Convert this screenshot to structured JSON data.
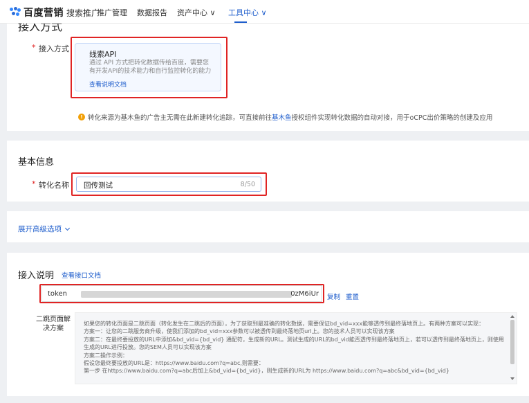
{
  "nav": {
    "brand": "百度营销",
    "brand_sub": "搜索推广",
    "items": [
      {
        "label": "推广管理"
      },
      {
        "label": "数据报告"
      },
      {
        "label": "资产中心"
      },
      {
        "label": "工具中心"
      }
    ],
    "active": "工具中心"
  },
  "access": {
    "section_title": "接入方式",
    "field_label": "接入方式",
    "required_mark": "*",
    "card": {
      "title": "线索API",
      "desc": "通过 API 方式把转化数据传给百度，需要您有开发API的技术能力和自行监控转化的能力",
      "link": "查看说明文档"
    },
    "notice": {
      "icon": "info-icon",
      "before": "转化来源为基木鱼的广告主无需在此新建转化追踪，可直接前往",
      "link": "基木鱼",
      "after": "授权组件实现转化数据的自动对接，用于oCPC出价策略的创建及应用"
    }
  },
  "basic": {
    "section_title": "基本信息",
    "field_label": "转化名称",
    "required_mark": "*",
    "value": "回传测试",
    "counter": "8/50"
  },
  "advanced": {
    "label": "展开高级选项"
  },
  "integration": {
    "section_title": "接入说明",
    "doc_link": "查看接口文档",
    "token": {
      "label": "token",
      "mask": "••••••••••••••••••••••••••••••••••••••••",
      "suffix": "0zM6iUr",
      "copy": "复制",
      "reset": "重置"
    },
    "solution_label": "二跳页面解决方案",
    "solution_lines": [
      "如果您的转化页面是二跳页面（转化发生在二跳后的页面），为了获取到最准确的转化数据，需要保证bd_vid=xxx能够透传到最终落地页上。有两种方案可以实现：",
      "方案一：让您的二跳服务商升级，使我们添加的bd_vid=xxx参数可以被透传到最终落地页url上。您的技术人员可以实现该方案",
      "方案二：在最终要投放的URL中添加&bd_vid={bd_vid} 通配符，生成新的URL。测试生成的URL的bd_vid能否透传到最终落地页上，若可以透传到最终落地页上，则使用生成的URL进行投放。您的SEM人员可以实现该方案",
      "方案二操作示例：",
      "假设您最终要投放的URL是：https://www.baidu.com?q=abc,则需要：",
      "第一步 在https://www.baidu.com?q=abc后加上&bd_vid={bd_vid}，则生成新的URL为 https://www.baidu.com?q=abc&bd_vid={bd_vid}"
    ]
  }
}
